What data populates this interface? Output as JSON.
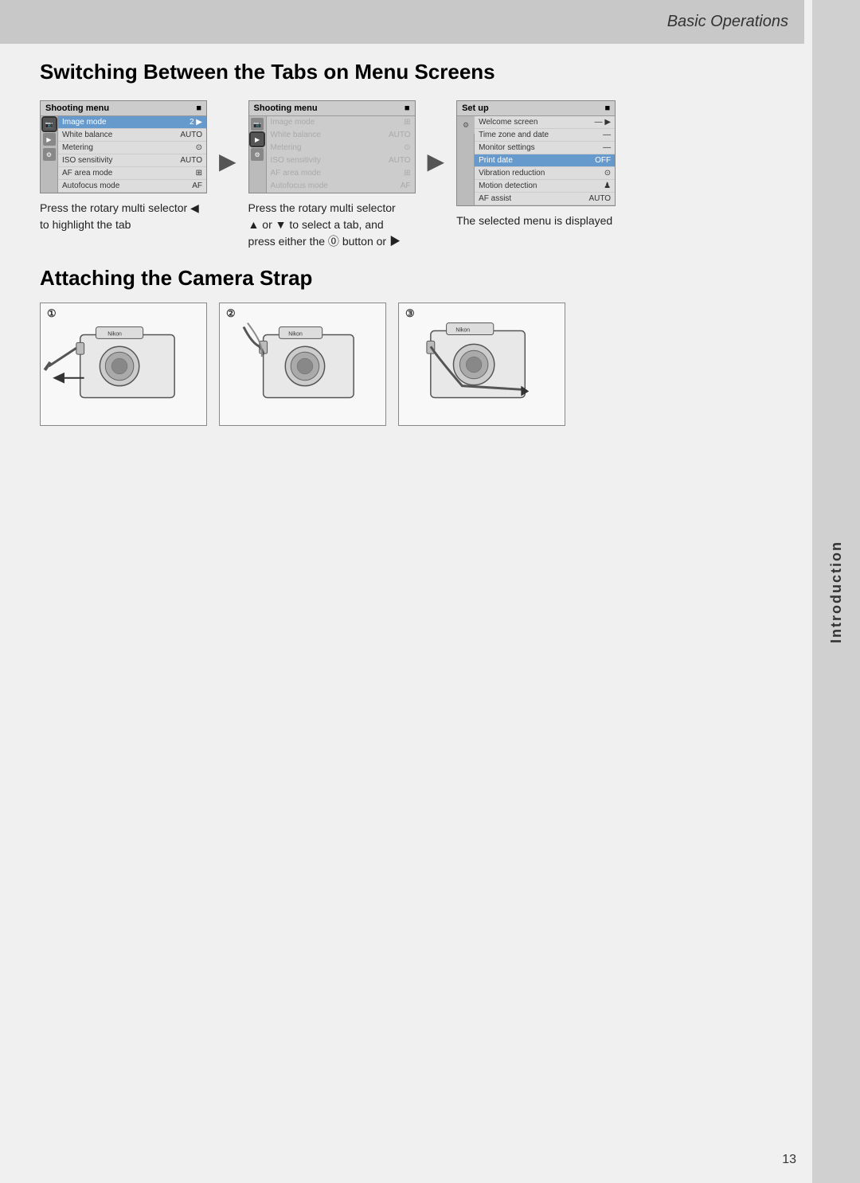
{
  "header": {
    "title": "Basic Operations",
    "section_label": "Introduction"
  },
  "section1": {
    "title": "Switching Between the Tabs on Menu Screens"
  },
  "section2": {
    "title": "Attaching the Camera Strap"
  },
  "menus": {
    "menu1": {
      "header": "Shooting menu",
      "items": [
        {
          "label": "Image mode",
          "value": "2 ▶",
          "highlighted": true
        },
        {
          "label": "White balance",
          "value": "AUTO",
          "highlighted": false
        },
        {
          "label": "Metering",
          "value": "⊙",
          "highlighted": false
        },
        {
          "label": "ISO sensitivity",
          "value": "AUTO",
          "highlighted": false
        },
        {
          "label": "AF area mode",
          "value": "⊞",
          "highlighted": false
        },
        {
          "label": "Autofocus mode",
          "value": "AF",
          "highlighted": false
        }
      ]
    },
    "menu2": {
      "header": "Shooting menu",
      "items": [
        {
          "label": "Image mode",
          "value": "⊞",
          "dimmed": true
        },
        {
          "label": "White balance",
          "value": "AUTO",
          "dimmed": true
        },
        {
          "label": "Metering",
          "value": "⊙",
          "dimmed": true
        },
        {
          "label": "ISO sensitivity",
          "value": "AUTO",
          "dimmed": true
        },
        {
          "label": "AF area mode",
          "value": "⊞",
          "dimmed": true
        },
        {
          "label": "Autofocus mode",
          "value": "AF",
          "dimmed": true
        }
      ]
    },
    "menu3": {
      "header": "Set up",
      "items": [
        {
          "label": "Welcome screen",
          "value": "— ▶"
        },
        {
          "label": "Time zone and date",
          "value": "—"
        },
        {
          "label": "Monitor settings",
          "value": "—"
        },
        {
          "label": "Print date",
          "value": "OFF",
          "highlighted": true
        },
        {
          "label": "Vibration reduction",
          "value": "⊙"
        },
        {
          "label": "Motion detection",
          "value": "♟"
        },
        {
          "label": "AF assist",
          "value": "AUTO"
        }
      ]
    }
  },
  "captions": {
    "caption1": "Press the rotary multi selector ◀ to highlight the tab",
    "caption2": "Press the rotary multi selector ▲ or ▼ to select a tab, and press either the ⓪ button or ▶",
    "caption3": "The selected menu is displayed"
  },
  "page_number": "13"
}
